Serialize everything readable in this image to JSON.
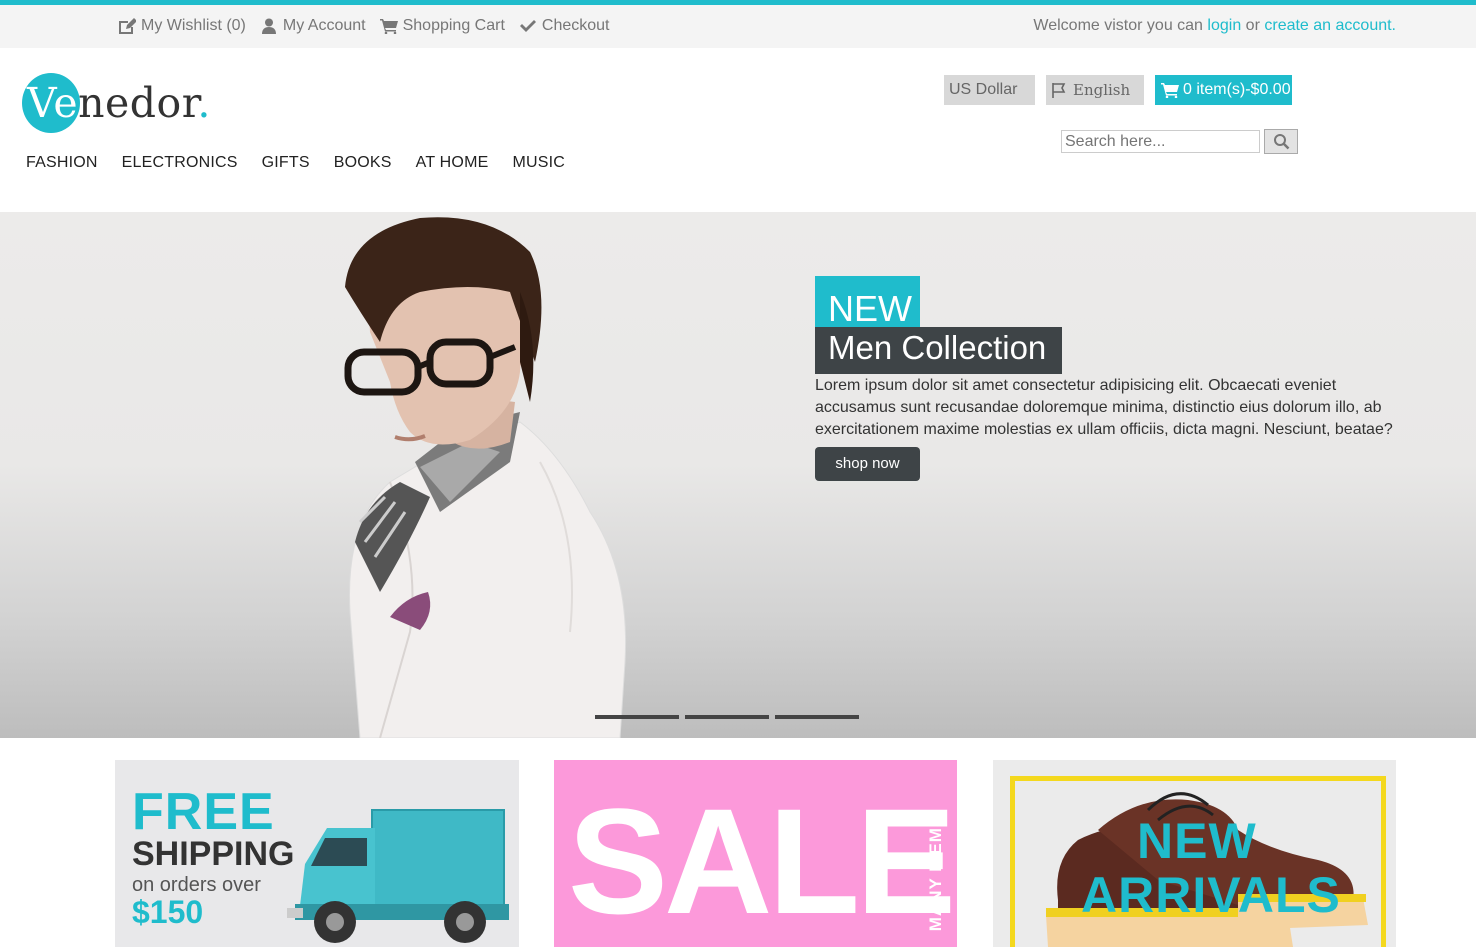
{
  "topbar": {
    "links": [
      {
        "label": "My Wishlist (0)",
        "icon": "edit-icon"
      },
      {
        "label": "My Account",
        "icon": "user-icon"
      },
      {
        "label": "Shopping Cart",
        "icon": "cart-icon"
      },
      {
        "label": "Checkout",
        "icon": "check-icon"
      }
    ],
    "welcome_text": "Welcome vistor you can",
    "login_label": "login",
    "or_text": "or",
    "create_account_label": "create an account."
  },
  "logo": {
    "prefix": "Ve",
    "rest": "nedor",
    "dot": "."
  },
  "nav": {
    "items": [
      "FASHION",
      "ELECTRONICS",
      "GIFTS",
      "BOOKS",
      "AT HOME",
      "MUSIC"
    ]
  },
  "header": {
    "currency": "US Dollar",
    "language": "English",
    "cart": "0 item(s)-$0.00",
    "search_placeholder": "Search here..."
  },
  "hero": {
    "tag": "NEW",
    "title": "Men Collection",
    "description": "Lorem ipsum dolor sit amet consectetur adipisicing elit. Obcaecati eveniet accusamus sunt recusandae doloremque minima, distinctio eius dolorum illo, ab exercitationem maxime molestias ex ullam officiis, dicta magni. Nesciunt, beatae?",
    "button": "shop now",
    "slides": 3
  },
  "promos": {
    "free_shipping": {
      "line1": "FREE",
      "line2": "SHIPPING",
      "line3": "on orders over",
      "price": "$150"
    },
    "sale": {
      "word": "SALE",
      "side": "MANY ITEMS"
    },
    "arrivals": {
      "line1": "NEW",
      "line2": "ARRIVALS"
    }
  },
  "colors": {
    "accent": "#1fbccc",
    "dark": "#3e4447",
    "pink": "#fc99da",
    "yellow": "#f4d81d"
  }
}
